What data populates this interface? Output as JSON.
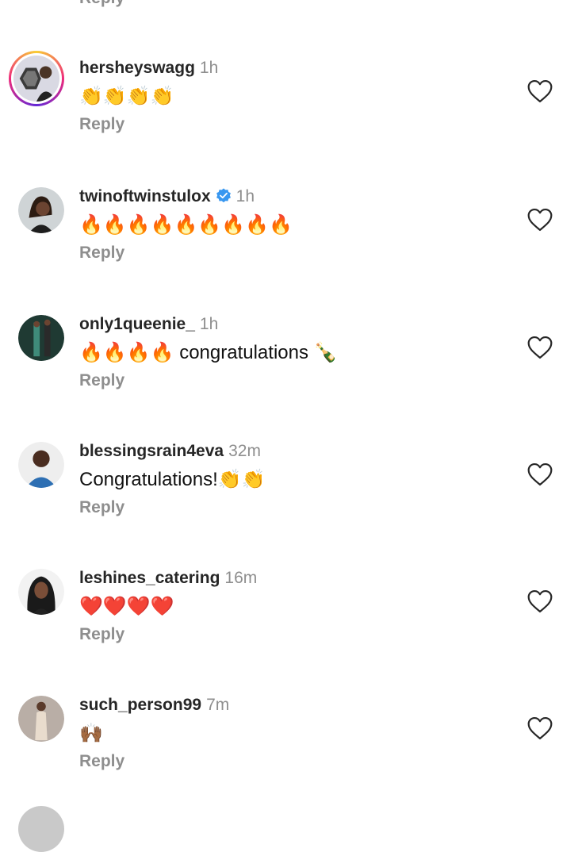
{
  "top_reply_label": "Reply",
  "colors": {
    "username": "#262626",
    "muted": "#8e8e8e",
    "verified": "#3897f0"
  },
  "comments": [
    {
      "username": "hersheyswagg",
      "time": "1h",
      "text": "👏👏👏👏",
      "reply_label": "Reply",
      "verified": false,
      "avatar_icon": "story-ring-avatar"
    },
    {
      "username": "twinoftwinstulox",
      "time": "1h",
      "text": "🔥🔥🔥🔥🔥🔥🔥🔥🔥",
      "reply_label": "Reply",
      "verified": true,
      "avatar_icon": "avatar"
    },
    {
      "username": "only1queenie_",
      "time": "1h",
      "text": "🔥🔥🔥🔥 congratulations 🍾",
      "reply_label": "Reply",
      "verified": false,
      "avatar_icon": "avatar"
    },
    {
      "username": "blessingsrain4eva",
      "time": "32m",
      "text": "Congratulations!👏👏",
      "reply_label": "Reply",
      "verified": false,
      "avatar_icon": "avatar"
    },
    {
      "username": "leshines_catering",
      "time": "16m",
      "text": "❤️❤️❤️❤️",
      "reply_label": "Reply",
      "verified": false,
      "avatar_icon": "avatar"
    },
    {
      "username": "such_person99",
      "time": "7m",
      "text": "🙌🏾",
      "reply_label": "Reply",
      "verified": false,
      "avatar_icon": "avatar"
    }
  ]
}
